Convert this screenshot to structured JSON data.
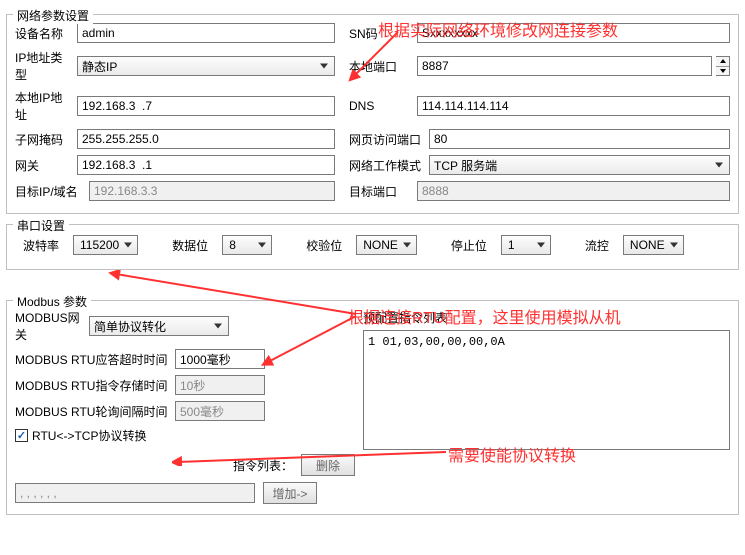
{
  "annotations": {
    "a1": "根据实际网络环境修改网连接参数",
    "a2": "根据连接RTU配置，这里使用模拟从机",
    "a3": "需要使能协议转换"
  },
  "network": {
    "legend": "网络参数设置",
    "deviceName": {
      "label": "设备名称",
      "value": "admin"
    },
    "sn": {
      "label": "SN码",
      "value": "Sxxxxxxxx"
    },
    "ipMode": {
      "label": "IP地址类型",
      "value": "静态IP"
    },
    "localPort": {
      "label": "本地端口",
      "value": "8887"
    },
    "localIp": {
      "label": "本地IP地址",
      "value": "192.168.3  .7"
    },
    "dns": {
      "label": "DNS",
      "value": "114.114.114.114"
    },
    "mask": {
      "label": "子网掩码",
      "value": "255.255.255.0"
    },
    "webPort": {
      "label": "网页访问端口",
      "value": "80"
    },
    "gateway": {
      "label": "网关",
      "value": "192.168.3  .1"
    },
    "netMode": {
      "label": "网络工作模式",
      "value": "TCP 服务端"
    },
    "targetIp": {
      "label": "目标IP/域名",
      "value": "192.168.3.3"
    },
    "targetPort": {
      "label": "目标端口",
      "value": "8888"
    }
  },
  "serial": {
    "legend": "串口设置",
    "baud": {
      "label": "波特率",
      "value": "115200"
    },
    "databits": {
      "label": "数据位",
      "value": "8"
    },
    "parity": {
      "label": "校验位",
      "value": "NONE"
    },
    "stopbits": {
      "label": "停止位",
      "value": "1"
    },
    "flow": {
      "label": "流控",
      "value": "NONE"
    }
  },
  "modbus": {
    "legend": "Modbus 参数",
    "gateway": {
      "label": "MODBUS网关",
      "value": "简单协议转化"
    },
    "rtuTimeout": {
      "label": "MODBUS RTU应答超时时间",
      "value": "1000毫秒"
    },
    "cmdStore": {
      "label": "MODBUS RTU指令存储时间",
      "value": "10秒"
    },
    "pollInterval": {
      "label": "MODBUS RTU轮询间隔时间",
      "value": "500毫秒"
    },
    "rtuTcpConv": {
      "label": "RTU<->TCP协议转换",
      "checked": true
    },
    "cmdList": {
      "label": "指令列表："
    },
    "btnDelete": "删除",
    "btnAdd": "增加->",
    "cmdInput": ", , , , , ,",
    "presetLabel": "预配置指令列表",
    "presetContent": "1 01,03,00,00,00,0A"
  }
}
